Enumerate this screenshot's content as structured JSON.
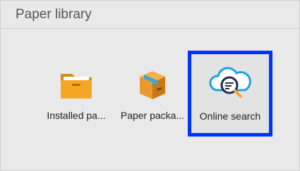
{
  "header": {
    "title": "Paper library"
  },
  "tiles": [
    {
      "label": "Installed pa..."
    },
    {
      "label": "Paper packa..."
    },
    {
      "label": "Online search"
    }
  ],
  "colors": {
    "selection": "#0033ff",
    "folder": "#f5a623",
    "box": "#e89a2f",
    "cloud": "#1aa3e6"
  },
  "icons": [
    "folder-icon",
    "package-box-icon",
    "cloud-search-icon"
  ]
}
